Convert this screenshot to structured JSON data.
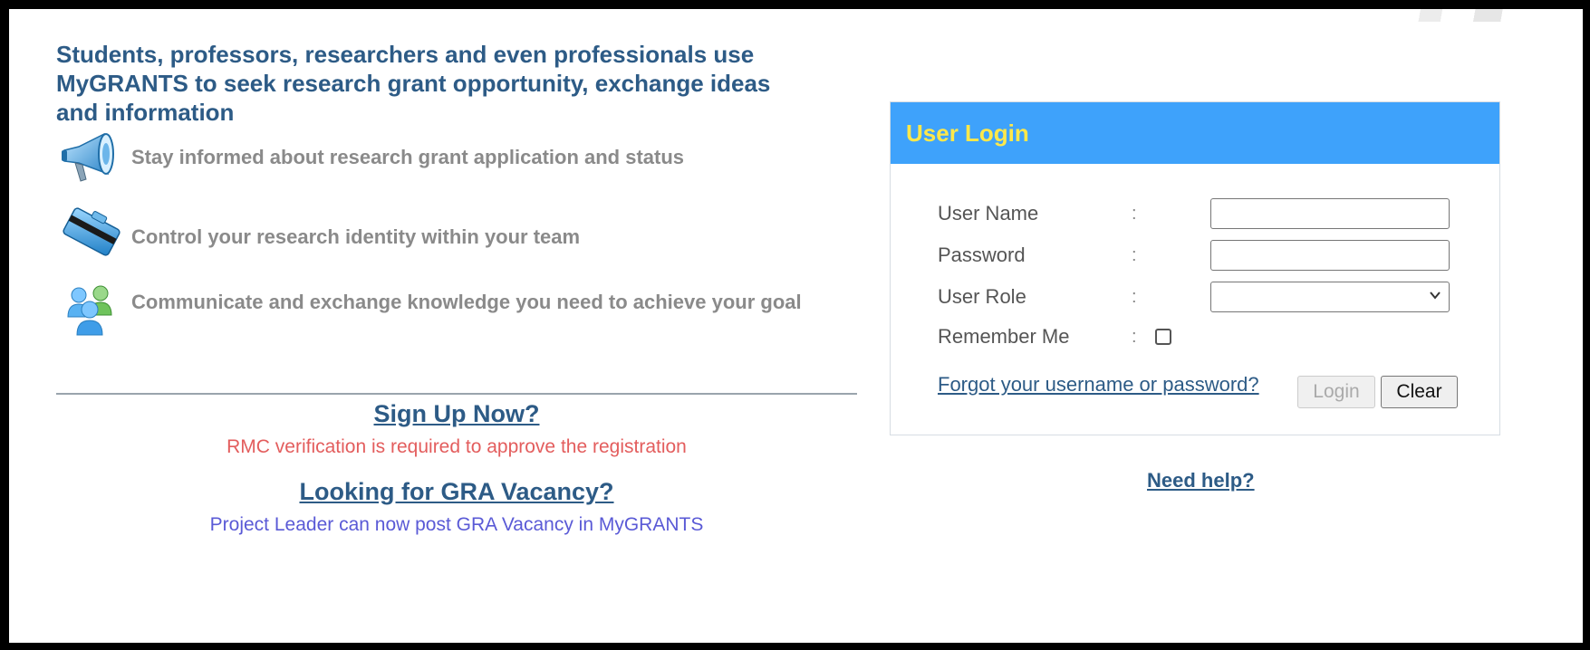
{
  "intro": {
    "headline_line1": "Students, professors, researchers and even professionals use",
    "headline_line2": "MyGRANTS to seek research grant opportunity, exchange ideas",
    "headline_line3": "and information"
  },
  "features": [
    {
      "icon": "megaphone-icon",
      "text": "Stay informed about research grant application and status"
    },
    {
      "icon": "id-card-icon",
      "text": "Control your research identity within your team"
    },
    {
      "icon": "users-group-icon",
      "text": "Communicate and exchange knowledge you need to achieve your goal"
    }
  ],
  "signup": {
    "link": "Sign Up Now?",
    "note": "RMC verification is required to approve the registration",
    "note_color": "#e35d5d"
  },
  "gra": {
    "link": "Looking for GRA Vacancy?",
    "note": "Project Leader can now post GRA Vacancy in MyGRANTS",
    "note_color": "#5a5ad6"
  },
  "login": {
    "title": "User Login",
    "header_color": "#3ea2fb",
    "title_color": "#ffe84a",
    "username_label": "User Name",
    "password_label": "Password",
    "role_label": "User Role",
    "remember_label": "Remember Me",
    "colon": ":",
    "username_value": "",
    "password_value": "",
    "role_value": "",
    "remember_checked": false,
    "forgot_link": "Forgot your username or password?",
    "login_button": "Login",
    "clear_button": "Clear"
  },
  "help_link": "Need help?"
}
